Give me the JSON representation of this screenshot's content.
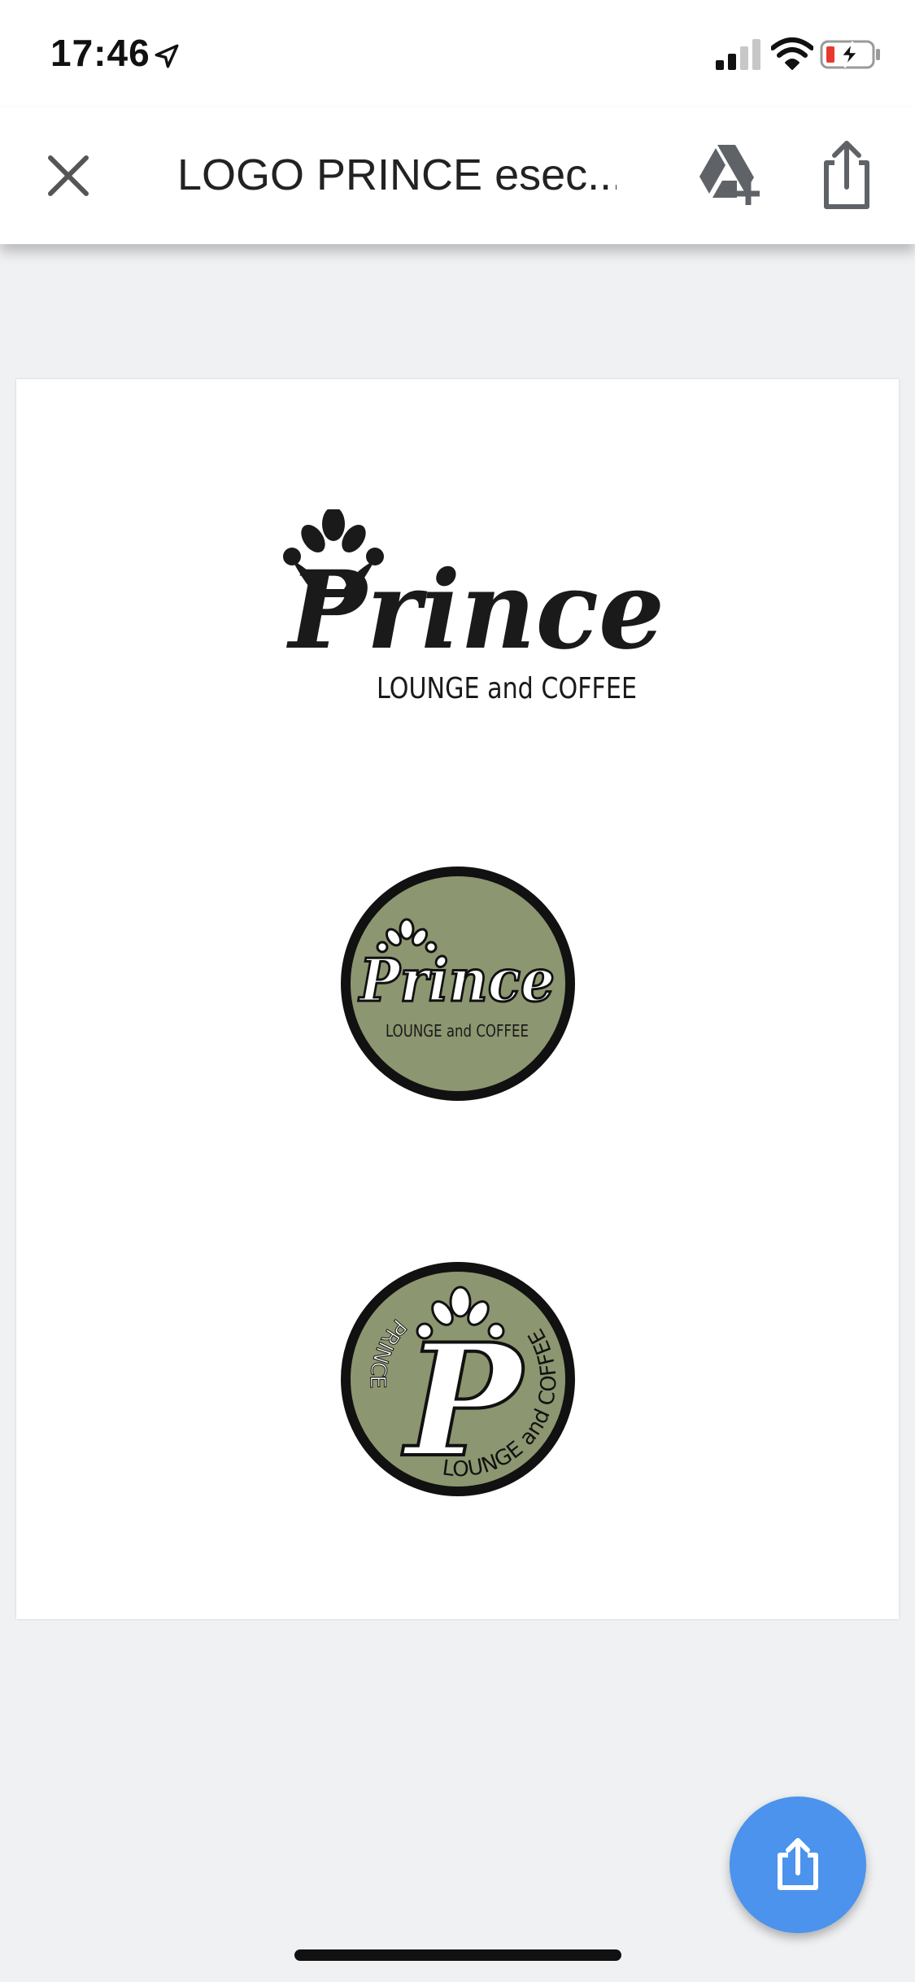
{
  "status_bar": {
    "time": "17:46",
    "icons": [
      "location-arrow-icon",
      "cellular-signal-icon",
      "wifi-icon",
      "battery-charging-icon"
    ],
    "battery_color": "#e8392f"
  },
  "toolbar": {
    "title": "LOGO PRINCE esec...",
    "close_icon": "close-icon",
    "drive_icon": "add-to-drive-icon",
    "share_icon": "share-icon"
  },
  "document": {
    "logos": [
      {
        "name": "Prince",
        "tagline": "LOUNGE and COFFEE"
      },
      {
        "name": "Prince",
        "tagline": "LOUNGE and COFFEE"
      },
      {
        "name": "PRINCE",
        "tagline": "LOUNGE and COFFEE"
      }
    ],
    "badge_color": "#8c9670"
  },
  "fab": {
    "icon": "share-icon",
    "color": "#4b93ec"
  }
}
